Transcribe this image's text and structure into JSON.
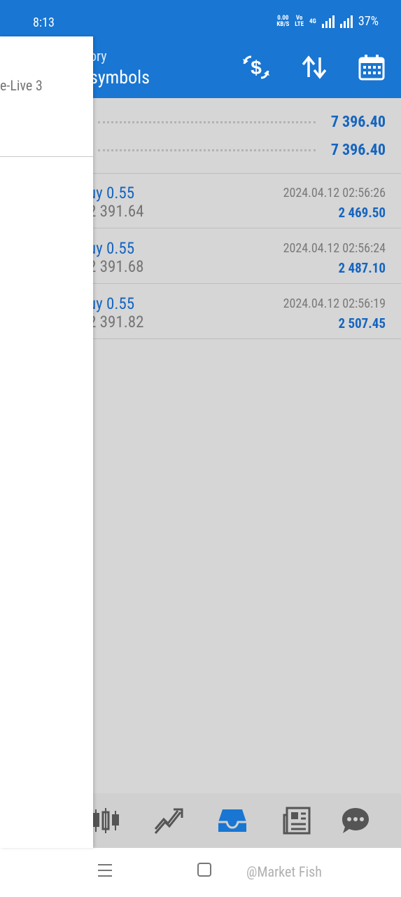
{
  "status_bar": {
    "time": "8:13",
    "net_speed_value": "0.00",
    "net_speed_unit": "KB/S",
    "vo_top": "Vo",
    "vo_bottom": "LTE",
    "network": "4G",
    "battery": "37%"
  },
  "header": {
    "subtitle": "ory",
    "title": "symbols",
    "icons": [
      "currency-exchange-icon",
      "sort-icon",
      "calendar-icon"
    ]
  },
  "summary": {
    "rows": [
      {
        "value": "7 396.40"
      },
      {
        "value": "7 396.40"
      }
    ]
  },
  "deals": [
    {
      "type": "uy 0.55",
      "price": "2 391.64",
      "time": "2024.04.12 02:56:26",
      "profit": "2 469.50"
    },
    {
      "type": "uy 0.55",
      "price": "2 391.68",
      "time": "2024.04.12 02:56:24",
      "profit": "2 487.10"
    },
    {
      "type": "uy 0.55",
      "price": "2 391.82",
      "time": "2024.04.12 02:56:19",
      "profit": "2 507.45"
    }
  ],
  "bottom_nav": {
    "items": [
      "candlestick-chart-icon",
      "trade-trend-icon",
      "inbox-history-icon",
      "news-icon",
      "chat-icon"
    ],
    "active_index": 2
  },
  "drawer": {
    "account_label": "e-Live 3"
  },
  "system_nav": {
    "watermark": "@Market Fish"
  },
  "colors": {
    "accent": "#1976d2",
    "value_blue": "#1565c0",
    "background": "#d6d6d6"
  }
}
